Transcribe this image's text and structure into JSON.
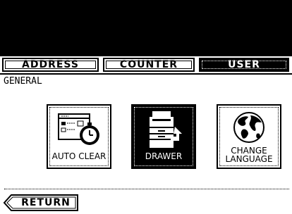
{
  "tabs": [
    {
      "label": "ADDRESS",
      "active": false
    },
    {
      "label": "COUNTER",
      "active": false
    },
    {
      "label": "USER",
      "active": true
    }
  ],
  "section": {
    "label": "GENERAL"
  },
  "tiles": [
    {
      "label": "AUTO CLEAR",
      "icon": "timer-clock-icon",
      "selected": false
    },
    {
      "label": "DRAWER",
      "icon": "copier-drawer-icon",
      "selected": true
    },
    {
      "label_line1": "CHANGE",
      "label_line2": "LANGUAGE",
      "icon": "globe-icon",
      "selected": false
    }
  ],
  "footer": {
    "return_label": "RETURN"
  },
  "colors": {
    "background": "#ffffff",
    "topbar": "#000000",
    "selected": "#000000"
  }
}
